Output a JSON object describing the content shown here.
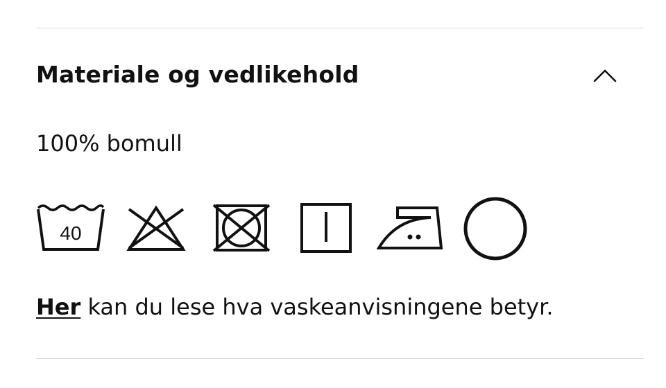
{
  "section": {
    "title": "Materiale og vedlikehold",
    "expanded": true,
    "toggle_icon": "chevron-up-icon"
  },
  "material": "100% bomull",
  "care_symbols": [
    {
      "icon": "wash-40-icon",
      "label": "40"
    },
    {
      "icon": "do-not-bleach-icon"
    },
    {
      "icon": "do-not-tumble-dry-icon"
    },
    {
      "icon": "line-dry-icon"
    },
    {
      "icon": "iron-medium-heat-icon"
    },
    {
      "icon": "dry-clean-icon"
    }
  ],
  "care_info": {
    "link_text": "Her",
    "rest_text": " kan du lese hva vaskeanvisningene betyr."
  },
  "colors": {
    "text": "#111111",
    "divider": "#d9d9d9",
    "background": "#ffffff"
  }
}
